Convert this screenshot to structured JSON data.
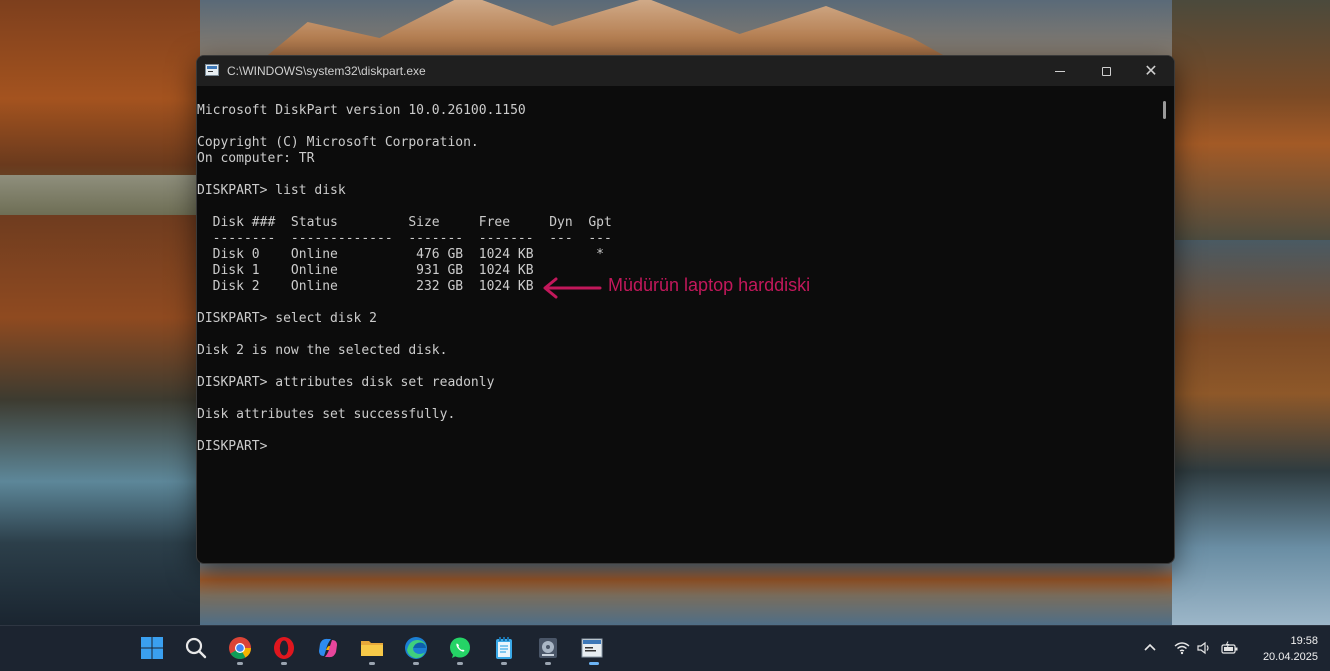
{
  "window": {
    "title": "C:\\WINDOWS\\system32\\diskpart.exe",
    "controls": {
      "minimize": "minimize-icon",
      "maximize": "maximize-icon",
      "close": "close-icon"
    }
  },
  "console": {
    "lines": [
      "Microsoft DiskPart version 10.0.26100.1150",
      "",
      "Copyright (C) Microsoft Corporation.",
      "On computer: TR",
      "",
      "DISKPART> list disk",
      "",
      "  Disk ###  Status         Size     Free     Dyn  Gpt",
      "  --------  -------------  -------  -------  ---  ---",
      "  Disk 0    Online          476 GB  1024 KB        *",
      "  Disk 1    Online          931 GB  1024 KB",
      "  Disk 2    Online          232 GB  1024 KB",
      "",
      "DISKPART> select disk 2",
      "",
      "Disk 2 is now the selected disk.",
      "",
      "DISKPART> attributes disk set readonly",
      "",
      "Disk attributes set successfully.",
      "",
      "DISKPART> "
    ]
  },
  "annotation": {
    "text": "Müdürün laptop harddiski",
    "color": "#c2185b"
  },
  "taskbar": {
    "apps": [
      {
        "name": "start-button",
        "icon": "windows-logo-icon",
        "running": false
      },
      {
        "name": "search-button",
        "icon": "search-icon",
        "running": false
      },
      {
        "name": "chrome-app",
        "icon": "chrome-icon",
        "running": true
      },
      {
        "name": "opera-app",
        "icon": "opera-icon",
        "running": true
      },
      {
        "name": "copilot-app",
        "icon": "copilot-icon",
        "running": false
      },
      {
        "name": "file-explorer-app",
        "icon": "folder-icon",
        "running": true
      },
      {
        "name": "edge-app",
        "icon": "edge-icon",
        "running": true
      },
      {
        "name": "whatsapp-app",
        "icon": "whatsapp-icon",
        "running": true
      },
      {
        "name": "notepad-app",
        "icon": "notepad-icon",
        "running": true
      },
      {
        "name": "disk-app",
        "icon": "disk-icon",
        "running": true
      },
      {
        "name": "diskpart-app",
        "icon": "console-icon",
        "running": true
      }
    ],
    "tray": {
      "chevron": "chevron-up-icon",
      "wifi": "wifi-icon",
      "volume": "volume-icon",
      "battery": "battery-icon"
    },
    "clock": {
      "time": "19:58",
      "date": "20.04.2025"
    }
  }
}
